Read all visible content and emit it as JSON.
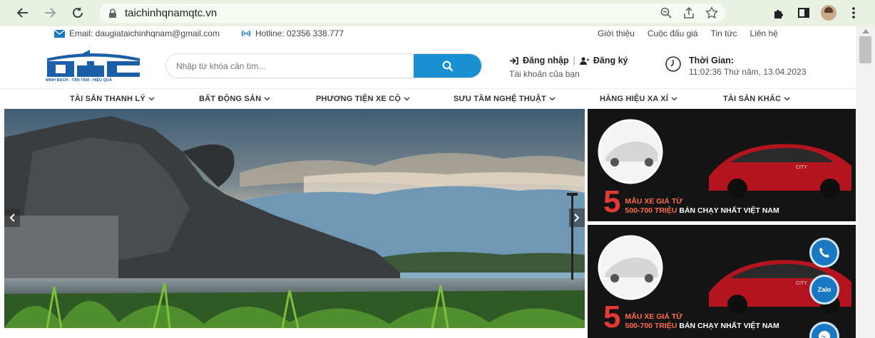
{
  "browser": {
    "url": "taichinhqnamqtc.vn"
  },
  "topbar": {
    "email": "Email: daugiataichinhqnam@gmail.com",
    "hotline": "Hotline: 02356 338.777",
    "links": [
      "Giới thiệu",
      "Cuộc đấu giá",
      "Tin tức",
      "Liên hệ"
    ]
  },
  "header": {
    "logo_tagline": "MINH BẠCH - TẬN TÂM - HIỆU QUẢ",
    "search_placeholder": "Nhập từ khóa cần tìm...",
    "login": "Đăng nhập",
    "register": "Đăng ký",
    "account_label": "Tài khoản của bạn",
    "time_label": "Thời Gian:",
    "time_value": "11:02:36 Thứ năm, 13.04.2023"
  },
  "menu": [
    "TÀI SẢN THANH LÝ",
    "BẤT ĐỘNG SẢN",
    "PHƯƠNG TIỆN XE CỘ",
    "SƯU TẦM NGHỆ THUẬT",
    "HÀNG HIỆU XA XỈ",
    "TÀI SẢN KHÁC"
  ],
  "banner": {
    "number": "5",
    "line1": "MẪU XE GIÁ TỪ",
    "line2_red": "500-700 TRIỆU",
    "line2_white": "BÁN CHẠY NHẤT VIỆT NAM",
    "car_badge": "CITY"
  },
  "float": {
    "zalo": "Zalo"
  },
  "colors": {
    "accent": "#1a8fd1",
    "browser_bar": "#e9f1e3",
    "banner_red": "#e53935"
  }
}
